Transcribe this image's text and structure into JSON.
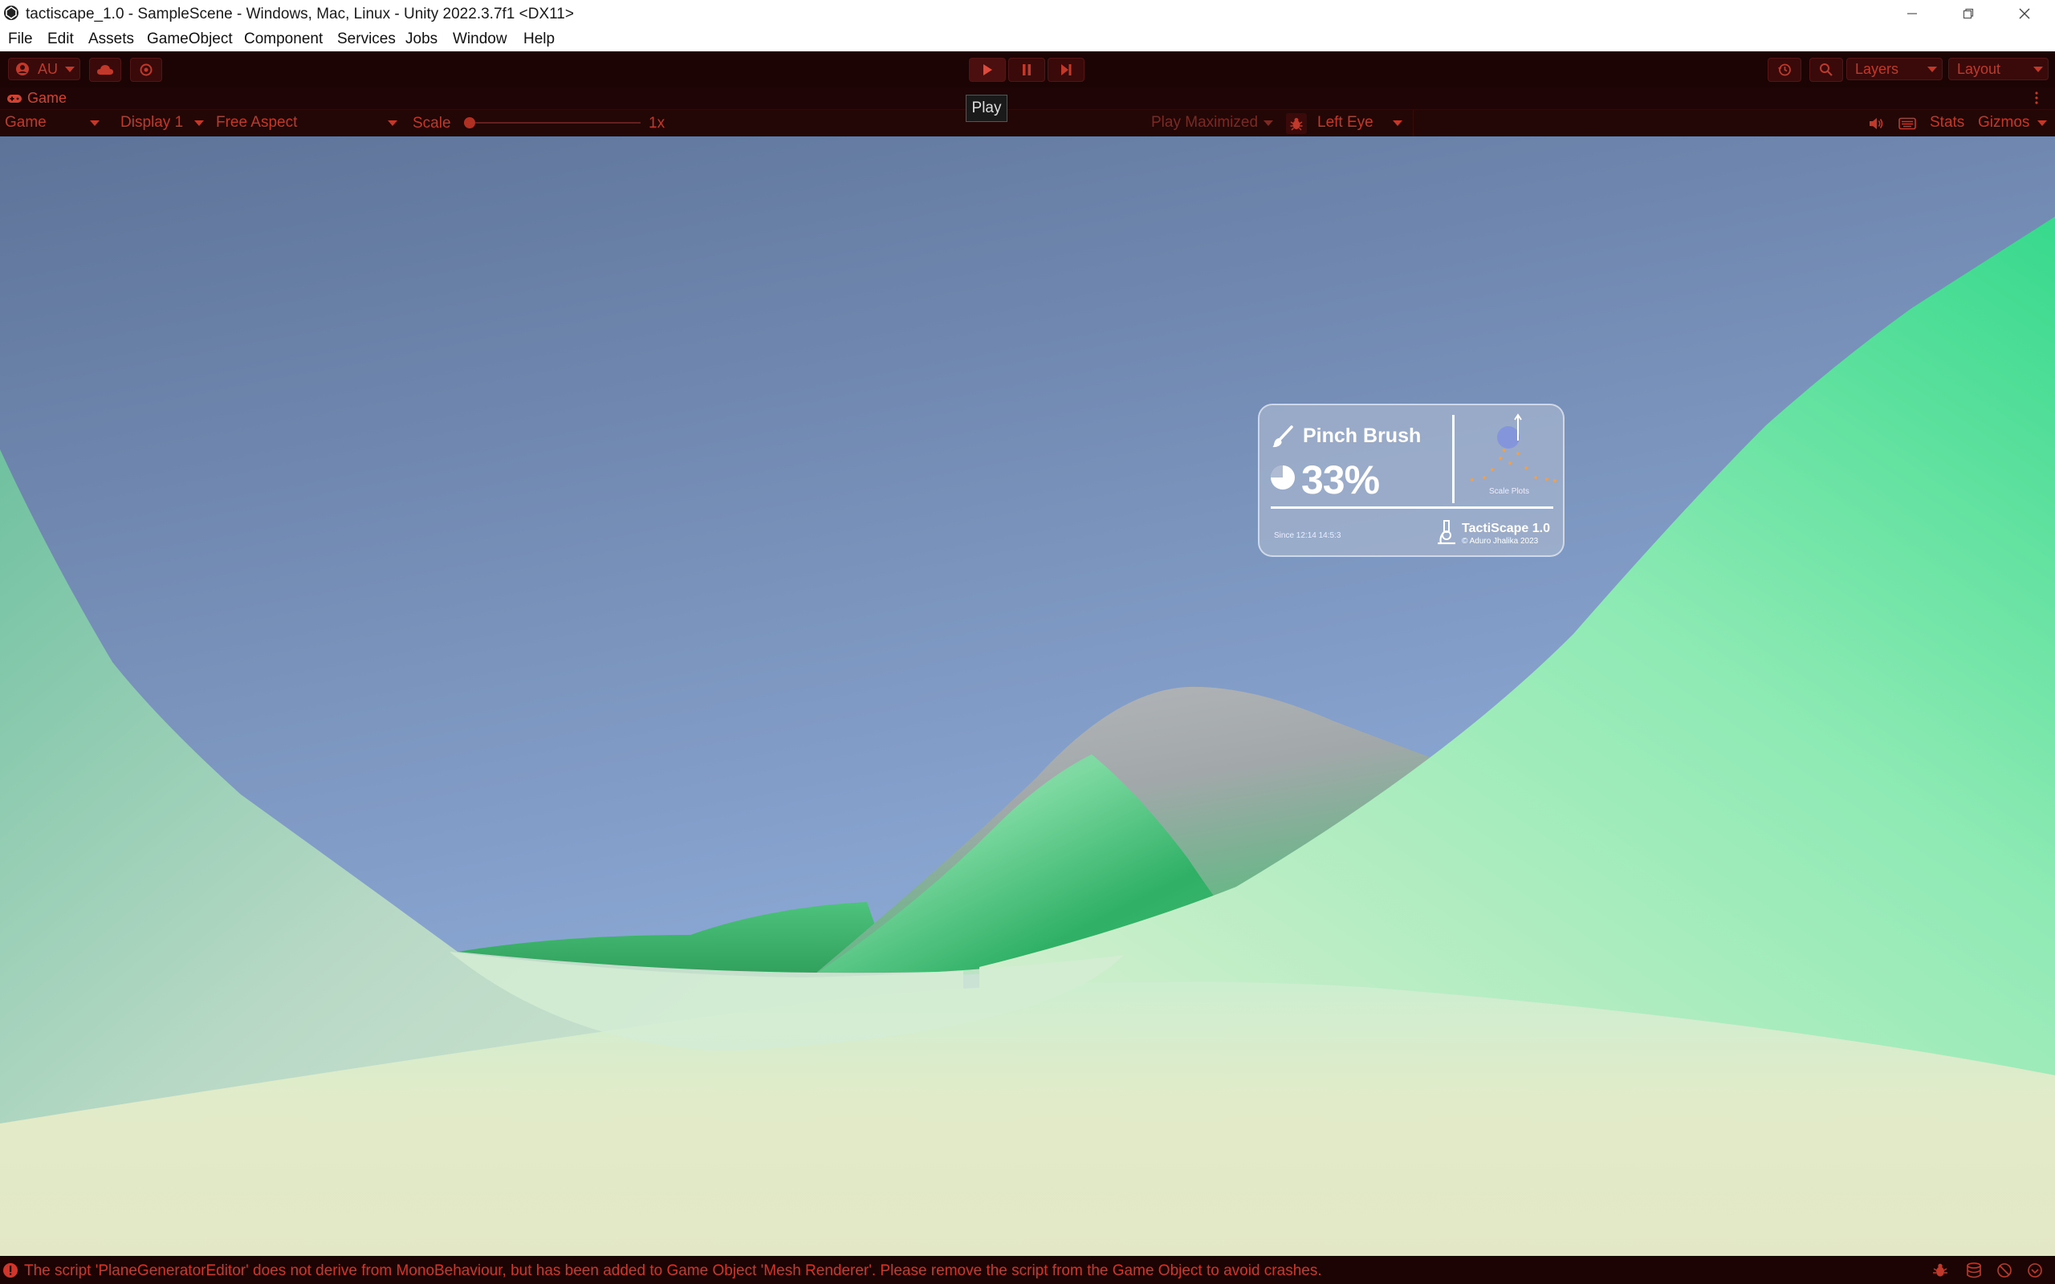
{
  "window": {
    "title": "tactiscape_1.0 - SampleScene - Windows, Mac, Linux - Unity 2022.3.7f1 <DX11>",
    "controls": [
      "minimize",
      "restore",
      "close"
    ]
  },
  "menu": [
    "File",
    "Edit",
    "Assets",
    "GameObject",
    "Component",
    "Services",
    "Jobs",
    "Window",
    "Help"
  ],
  "toolbar": {
    "account_label": "AU",
    "play_tooltip": "Play",
    "layers_label": "Layers",
    "layout_label": "Layout"
  },
  "game_tab": {
    "label": "Game"
  },
  "game_controls": {
    "view_select": "Game",
    "display_select": "Display 1",
    "aspect_select": "Free Aspect",
    "scale_label": "Scale",
    "scale_value": "1x",
    "scale_fraction": 0.0,
    "play_mode_select": "Play Maximized",
    "eye_select": "Left Eye",
    "stats_label": "Stats",
    "gizmos_label": "Gizmos"
  },
  "hud": {
    "tool_name": "Pinch Brush",
    "percentage": "33%",
    "diagram_label": "Scale Plots",
    "footer_left": "Since 12:14 14:5:3",
    "brand": "TactiScape 1.0",
    "copyright": "© Aduro Jhalika 2023"
  },
  "status": {
    "message": "The script 'PlaneGeneratorEditor' does not derive from MonoBehaviour, but has been added to Game Object 'Mesh Renderer'. Please remove the script from the Game Object to avoid crashes."
  },
  "colors": {
    "accent": "#c0392b",
    "toolbar_bg": "#1c0404",
    "sky_top": "#5e7398",
    "sky_bottom": "#92b0dc",
    "terrain_green": "#2fb066",
    "terrain_light": "#e3e8c4"
  }
}
